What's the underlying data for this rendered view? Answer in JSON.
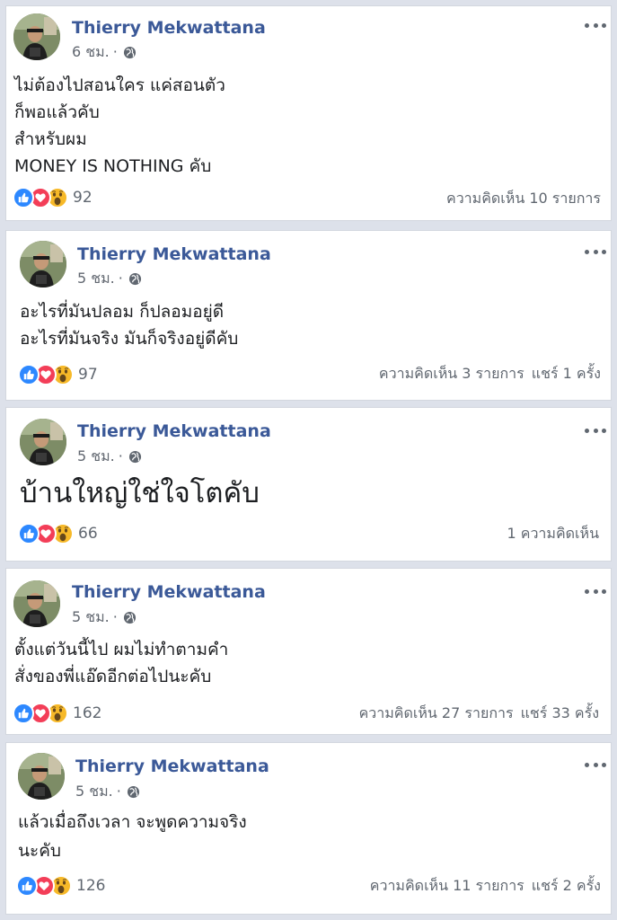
{
  "posts": [
    {
      "author": "Thierry Mekwattana",
      "time": "6 ชม.",
      "sep": "·",
      "lines": [
        "ไม่ต้องไปสอนใคร แค่สอนตัว",
        "ก็พอแล้วคับ",
        "สำหรับผม",
        "MONEY IS NOTHING คับ"
      ],
      "reactions": "92",
      "comments": "ความคิดเห็น 10 รายการ",
      "shares": ""
    },
    {
      "author": "Thierry Mekwattana",
      "time": "5 ชม.",
      "sep": "·",
      "lines": [
        "อะไรที่มันปลอม ก็ปลอมอยู่ดี",
        "อะไรที่มันจริง มันก็จริงอยู่ดีคับ"
      ],
      "reactions": "97",
      "comments": "ความคิดเห็น 3 รายการ",
      "shares": "แชร์ 1 ครั้ง"
    },
    {
      "author": "Thierry Mekwattana",
      "time": "5 ชม.",
      "sep": "·",
      "lines": [
        "บ้านใหญ่ใช่ใจโตคับ"
      ],
      "reactions": "66",
      "comments": "1 ความคิดเห็น",
      "shares": ""
    },
    {
      "author": "Thierry Mekwattana",
      "time": "5 ชม.",
      "sep": "·",
      "lines": [
        "ตั้งแต่วันนี้ไป ผมไม่ทำตามคำ",
        "สั่งของพี่แอ๊ดอีกต่อไปนะคับ"
      ],
      "reactions": "162",
      "comments": "ความคิดเห็น 27 รายการ",
      "shares": "แชร์ 33 ครั้ง"
    },
    {
      "author": "Thierry Mekwattana",
      "time": "5 ชม.",
      "sep": "·",
      "lines": [
        "แล้วเมื่อถึงเวลา จะพูดความจริง",
        "นะคับ"
      ],
      "reactions": "126",
      "comments": "ความคิดเห็น 11 รายการ",
      "shares": "แชร์ 2 ครั้ง"
    }
  ],
  "icons": {
    "avatar": "profile-photo",
    "privacy": "globe-icon",
    "menu": "more-options-icon",
    "reactions": [
      "like-icon",
      "love-icon",
      "wow-icon"
    ]
  },
  "colors": {
    "author": "#3b5998",
    "like": "#2d88ff",
    "love": "#f33e58",
    "wow": "#f7b928",
    "background": "#dde1ea"
  }
}
